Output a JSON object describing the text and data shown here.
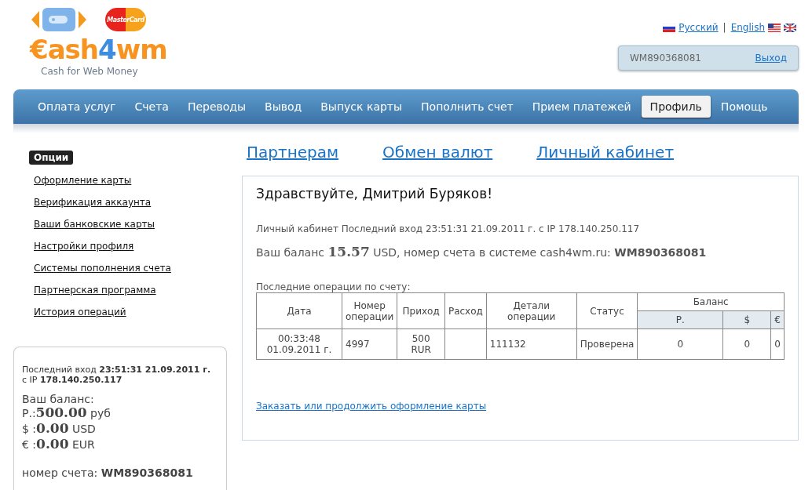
{
  "logo": {
    "part_1": "€ash",
    "part_2": "4",
    "part_3": "wm",
    "tagline": "Cash for Web Money",
    "card_mark": "MasterCard"
  },
  "languages": [
    {
      "label": "Русский",
      "kind": "ru"
    },
    {
      "label": "English",
      "kind": "en"
    }
  ],
  "language_separator": "|",
  "account_box": {
    "account": "WM890368081",
    "logout": "Выход"
  },
  "nav": [
    {
      "label": "Оплата услуг",
      "selected": false
    },
    {
      "label": "Счета",
      "selected": false
    },
    {
      "label": "Переводы",
      "selected": false
    },
    {
      "label": "Вывод",
      "selected": false
    },
    {
      "label": "Выпуск карты",
      "selected": false
    },
    {
      "label": "Пополнить счет",
      "selected": false
    },
    {
      "label": "Прием платежей",
      "selected": false
    },
    {
      "label": "Профиль",
      "selected": true
    },
    {
      "label": "Помощь",
      "selected": false
    }
  ],
  "sidebar": {
    "heading": "Опции",
    "items": [
      "Оформление карты",
      "Верификация аккаунта",
      "Ваши банковские карты",
      "Настройки профиля",
      "Системы пополнения счета",
      "Партнерская программа",
      "История операций"
    ],
    "info": {
      "last_login": "Последний вход **23:51:31 21.09.2011 г.**",
      "ip": "с IP **178.140.250.117**",
      "balance_title": "Ваш баланс:",
      "balances": [
        "Р.:**500.00** руб",
        "$ :**0.00** USD",
        "€ :**0.00** EUR"
      ],
      "account": "номер счета: **WM890368081**"
    }
  },
  "top_links": [
    "Партнерам",
    "Обмен валют",
    "Личный кабинет"
  ],
  "main": {
    "greeting": "Здравствуйте, Дмитрий Буряков!",
    "last_login": "Личный кабинет Последний вход 23:51:31 21.09.2011 г. с IP 178.140.250.117",
    "balance": "Ваш баланс **15.57** USD, номер счета в системе cash4wm.ru: **WM890368081**",
    "table_caption": "Последние операции по счету:",
    "table": {
      "columns": [
        "Дата",
        "Номер операции",
        "Приход",
        "Расход",
        "Детали операции",
        "Статус"
      ],
      "balance_group": "Баланс",
      "balance_columns": [
        "Р.",
        "$",
        "€"
      ],
      "rows": [
        {
          "date": "00:33:48 01.09.2011 г.",
          "number": "4997",
          "income": "500 RUR",
          "details": "111132",
          "status": "Проверена",
          "balances": [
            "0",
            "0",
            "0"
          ]
        }
      ]
    },
    "order_link": "Заказать или продолжить оформление карты"
  }
}
